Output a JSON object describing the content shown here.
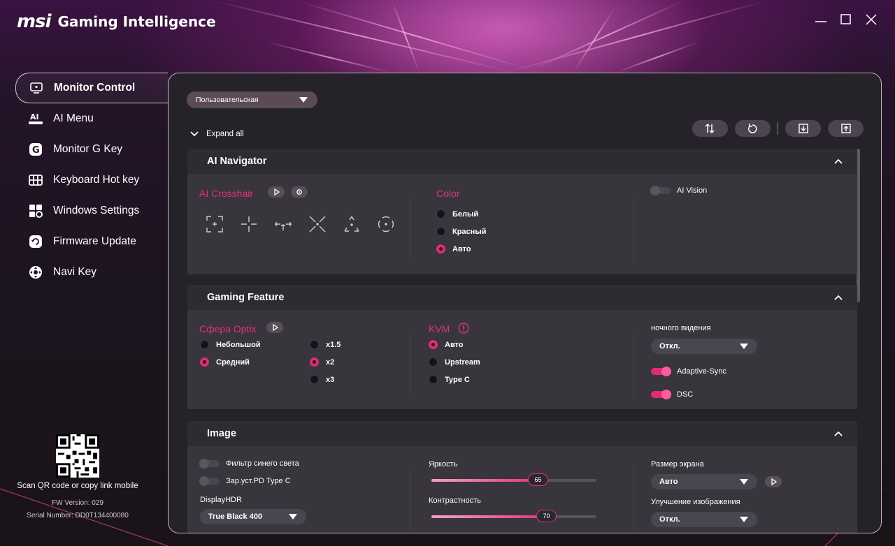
{
  "app": {
    "brand": "msi",
    "title": "Gaming Intelligence"
  },
  "window_controls": {
    "minimize": "minimize-icon",
    "maximize": "maximize-icon",
    "close": "close-icon"
  },
  "sidebar": {
    "items": [
      {
        "label": "Monitor Control",
        "icon": "monitor-icon",
        "active": true
      },
      {
        "label": "AI Menu",
        "icon": "ai-menu-icon",
        "active": false
      },
      {
        "label": "Monitor G Key",
        "icon": "g-key-icon",
        "active": false
      },
      {
        "label": "Keyboard Hot key",
        "icon": "keyboard-icon",
        "active": false
      },
      {
        "label": "Windows Settings",
        "icon": "windows-settings-icon",
        "active": false
      },
      {
        "label": "Firmware Update",
        "icon": "firmware-update-icon",
        "active": false
      },
      {
        "label": "Navi Key",
        "icon": "navi-key-icon",
        "active": false
      }
    ],
    "footer": {
      "scan_text": "Scan QR code or copy link mobile",
      "fw_version": "FW Version: 029",
      "serial": "Serial Number: DD0T134400080"
    }
  },
  "main": {
    "preset": "Пользовательская",
    "expand_all": "Expand all",
    "toolbar": [
      "sort-icon",
      "reset-icon",
      "import-icon",
      "export-icon"
    ],
    "sections": {
      "ai_navigator": {
        "title": "AI Navigator",
        "crosshair_title": "AI Crosshair",
        "color_title": "Color",
        "colors": [
          {
            "label": "Белый",
            "selected": false
          },
          {
            "label": "Красный",
            "selected": false
          },
          {
            "label": "Авто",
            "selected": true
          }
        ],
        "ai_vision": {
          "label": "AI Vision",
          "on": false
        }
      },
      "gaming_feature": {
        "title": "Gaming Feature",
        "optix_title": "Сфера Optix",
        "sizes": [
          {
            "label": "Небольшой",
            "selected": false
          },
          {
            "label": "Средний",
            "selected": true
          }
        ],
        "zooms": [
          {
            "label": "x1.5",
            "selected": false
          },
          {
            "label": "x2",
            "selected": true
          },
          {
            "label": "x3",
            "selected": false
          }
        ],
        "kvm_title": "KVM",
        "kvm": [
          {
            "label": "Авто",
            "selected": true
          },
          {
            "label": "Upstream",
            "selected": false
          },
          {
            "label": "Type C",
            "selected": false
          }
        ],
        "night_vision_label": "ночного видения",
        "night_vision_value": "Откл.",
        "adaptive_sync": {
          "label": "Adaptive-Sync",
          "on": true
        },
        "dsc": {
          "label": "DSC",
          "on": true
        }
      },
      "image": {
        "title": "Image",
        "blue_light": {
          "label": "Фильтр синего света",
          "on": false
        },
        "pd_typec": {
          "label": "Зар.уст.PD Type C",
          "on": false
        },
        "hdr_label": "DisplayHDR",
        "hdr_value": "True Black 400",
        "brightness_label": "Яркость",
        "brightness": 65,
        "contrast_label": "Контрастность",
        "contrast": 70,
        "screen_size_label": "Размер экрана",
        "screen_size_value": "Авто",
        "enhance_label": "Улучшение изображения",
        "enhance_value": "Откл."
      }
    }
  },
  "colors": {
    "accent": "#e0337e",
    "panel": "#252329",
    "section": "#38353c"
  }
}
